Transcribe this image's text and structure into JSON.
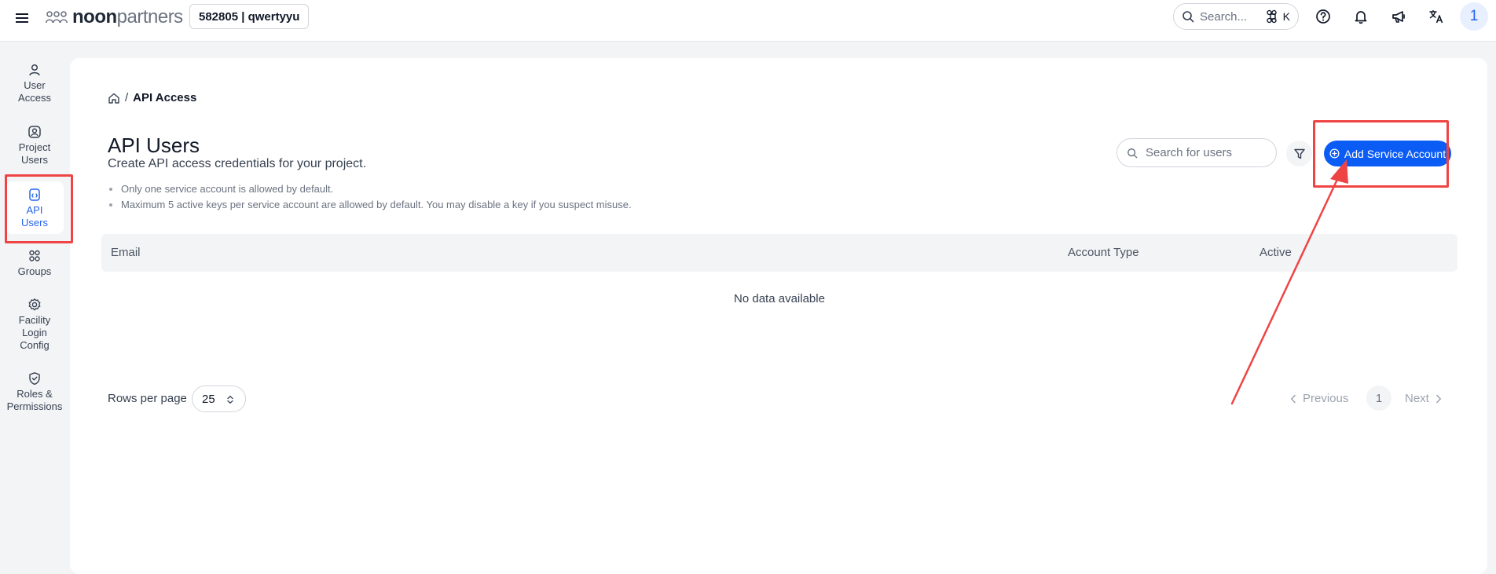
{
  "topbar": {
    "logo_bold": "noon",
    "logo_light": "partners",
    "project_label": "582805 | qwertyyu",
    "search_placeholder": "Search...",
    "search_shortcut_key": "K",
    "avatar_initial": "1",
    "icons": [
      "menu-icon",
      "help-circle-icon",
      "bell-icon",
      "megaphone-icon",
      "translate-icon"
    ]
  },
  "sidebar": {
    "items": [
      {
        "label": "User\nAccess",
        "icon": "user-icon",
        "active": false
      },
      {
        "label": "Project\nUsers",
        "icon": "user-badge-icon",
        "active": false
      },
      {
        "label": "API\nUsers",
        "icon": "api-icon",
        "active": true
      },
      {
        "label": "Groups",
        "icon": "groups-icon",
        "active": false
      },
      {
        "label": "Facility\nLogin\nConfig",
        "icon": "gear-icon",
        "active": false
      },
      {
        "label": "Roles &\nPermissions",
        "icon": "shield-check-icon",
        "active": false
      }
    ]
  },
  "breadcrumb": {
    "current": "API Access"
  },
  "page": {
    "title": "API Users",
    "subtitle": "Create API access credentials for your project.",
    "notes": [
      "Only one service account is allowed by default.",
      "Maximum 5 active keys per service account are allowed by default. You may disable a key if you suspect misuse."
    ]
  },
  "actions": {
    "search_placeholder": "Search for users",
    "add_button_label": "Add Service Account"
  },
  "table": {
    "columns": [
      "Email",
      "Account Type",
      "Active"
    ],
    "empty_text": "No data available"
  },
  "pagination": {
    "rows_per_page_label": "Rows per page",
    "rows_per_page_value": "25",
    "previous_label": "Previous",
    "current_page": "1",
    "next_label": "Next"
  },
  "colors": {
    "primary": "#0b5cf5",
    "active_nav": "#2563eb",
    "annotation": "#ef4444"
  }
}
